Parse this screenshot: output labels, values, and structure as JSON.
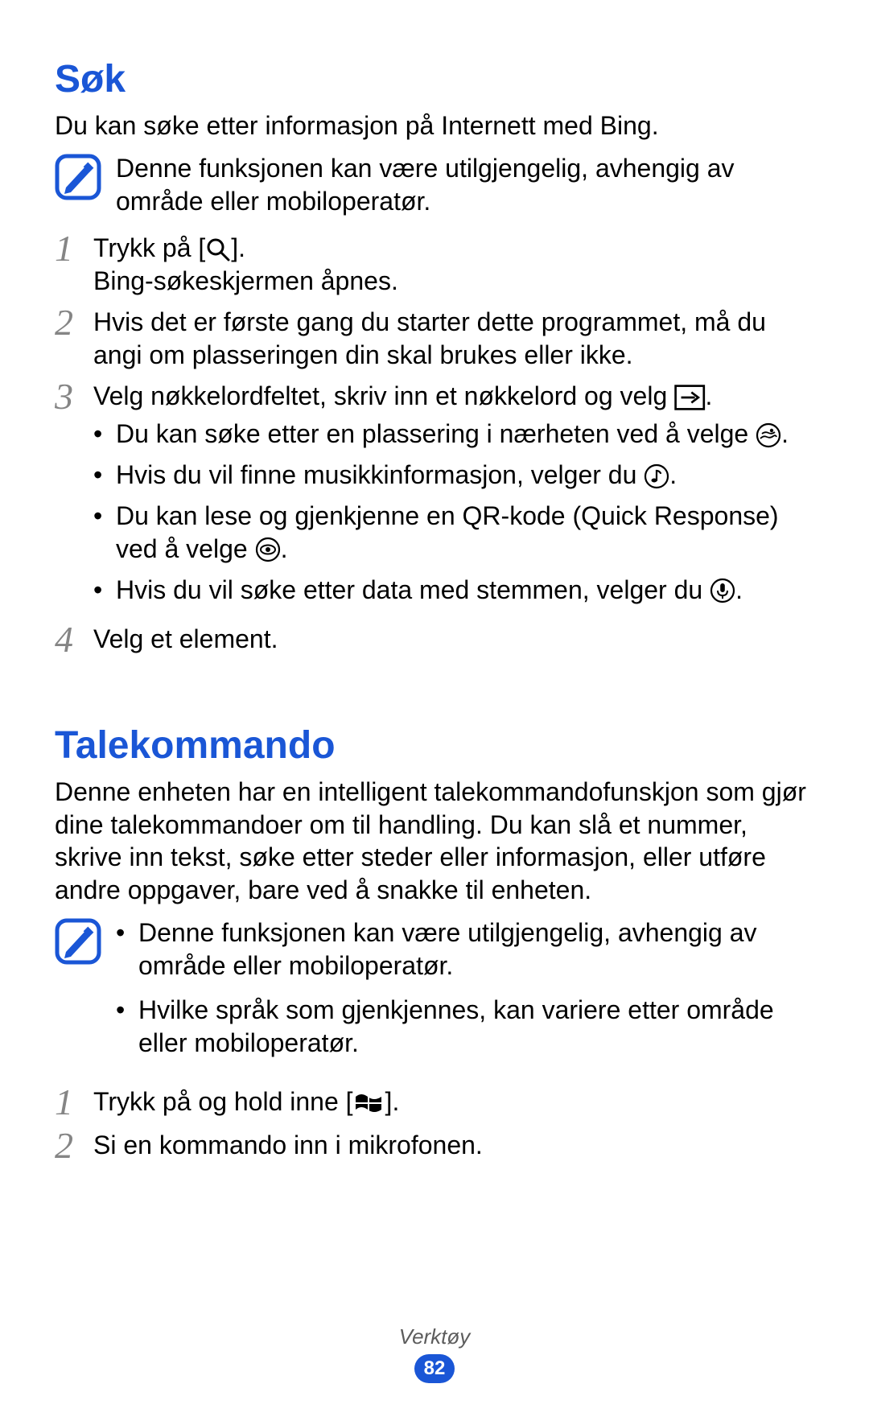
{
  "sections": {
    "sok": {
      "heading": "Søk",
      "intro": "Du kan søke etter informasjon på Internett med Bing.",
      "note": "Denne funksjonen kan være utilgjengelig, avhengig av område eller mobiloperatør.",
      "steps": {
        "s1": {
          "num": "1",
          "line1_a": "Trykk på [",
          "line1_b": "].",
          "line2": "Bing-søkeskjermen åpnes."
        },
        "s2": {
          "num": "2",
          "text": "Hvis det er første gang du starter dette programmet, må du angi om plasseringen din skal brukes eller ikke."
        },
        "s3": {
          "num": "3",
          "line_a": "Velg nøkkelordfeltet, skriv inn et nøkkelord og velg ",
          "line_b": ".",
          "bullets": {
            "b1_a": "Du kan søke etter en plassering i nærheten ved å velge ",
            "b1_b": ".",
            "b2_a": "Hvis du vil finne musikkinformasjon, velger du ",
            "b2_b": ".",
            "b3_a": "Du kan lese og gjenkjenne en QR-kode (Quick Response) ved å velge ",
            "b3_b": ".",
            "b4_a": "Hvis du vil søke etter data med stemmen, velger du ",
            "b4_b": "."
          }
        },
        "s4": {
          "num": "4",
          "text": "Velg et element."
        }
      }
    },
    "talekommando": {
      "heading": "Talekommando",
      "intro": "Denne enheten har en intelligent talekommandofunskjon som gjør dine talekommandoer om til handling. Du kan slå et nummer, skrive inn tekst, søke etter steder eller informasjon, eller utføre andre oppgaver, bare ved å snakke til enheten.",
      "notes": {
        "n1": "Denne funksjonen kan være utilgjengelig, avhengig av område eller mobiloperatør.",
        "n2": "Hvilke språk som gjenkjennes, kan variere etter område eller mobiloperatør."
      },
      "steps": {
        "s1": {
          "num": "1",
          "line_a": "Trykk på og hold inne [",
          "line_b": "]."
        },
        "s2": {
          "num": "2",
          "text": "Si en kommando inn i mikrofonen."
        }
      }
    }
  },
  "footer": {
    "section": "Verktøy",
    "page": "82"
  }
}
